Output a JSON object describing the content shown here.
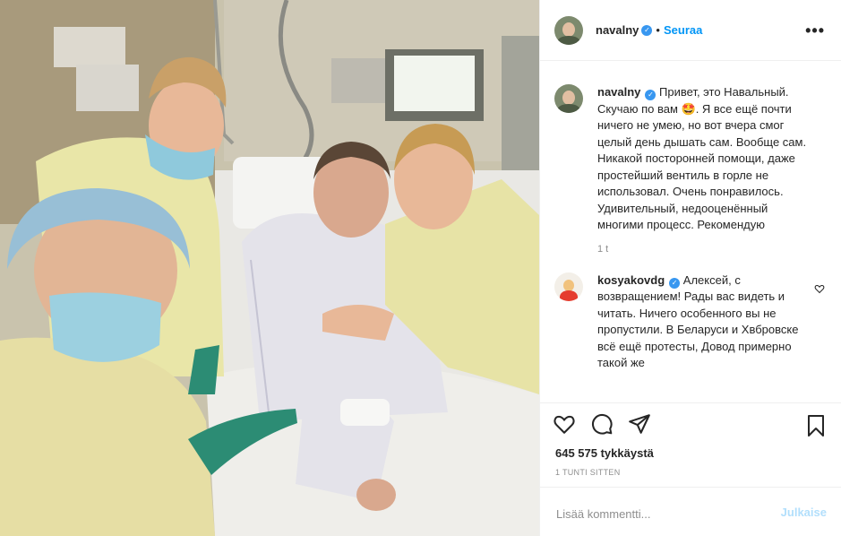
{
  "post": {
    "author": "navalny",
    "follow_label": "Seuraa",
    "more_icon": "more-dots-icon",
    "caption": {
      "username": "navalny",
      "text": "Привет, это Навальный. Скучаю по вам 🤩. Я все ещё почти ничего не умею, но вот вчера смог целый день дышать сам. Вообще сам. Никакой посторонней помощи, даже простейший вентиль в горле не использовал. Очень понравилось. Удивительный, недооценённый многими процесс. Рекомендую",
      "time": "1 t"
    },
    "comments": [
      {
        "username": "kosyakovdg",
        "text": "Алексей, с возвращением! Рады вас видеть и читать. Ничего особенного вы не пропустили. В Беларуси и Хвбровске всё ещё протесты, Довод примерно такой же"
      }
    ],
    "likes": "645 575 tykkäystä",
    "time_ago": "1 TUNTI SITTEN",
    "add_comment_placeholder": "Lisää kommentti...",
    "publish_label": "Julkaise"
  },
  "icons": {
    "like": "heart-icon",
    "comment": "comment-icon",
    "share": "paper-plane-icon",
    "save": "bookmark-icon"
  },
  "colors": {
    "follow": "#0095f6",
    "publish_disabled": "#b2dffc",
    "secondary_text": "#8e8e8e",
    "verified": "#3897f0"
  }
}
